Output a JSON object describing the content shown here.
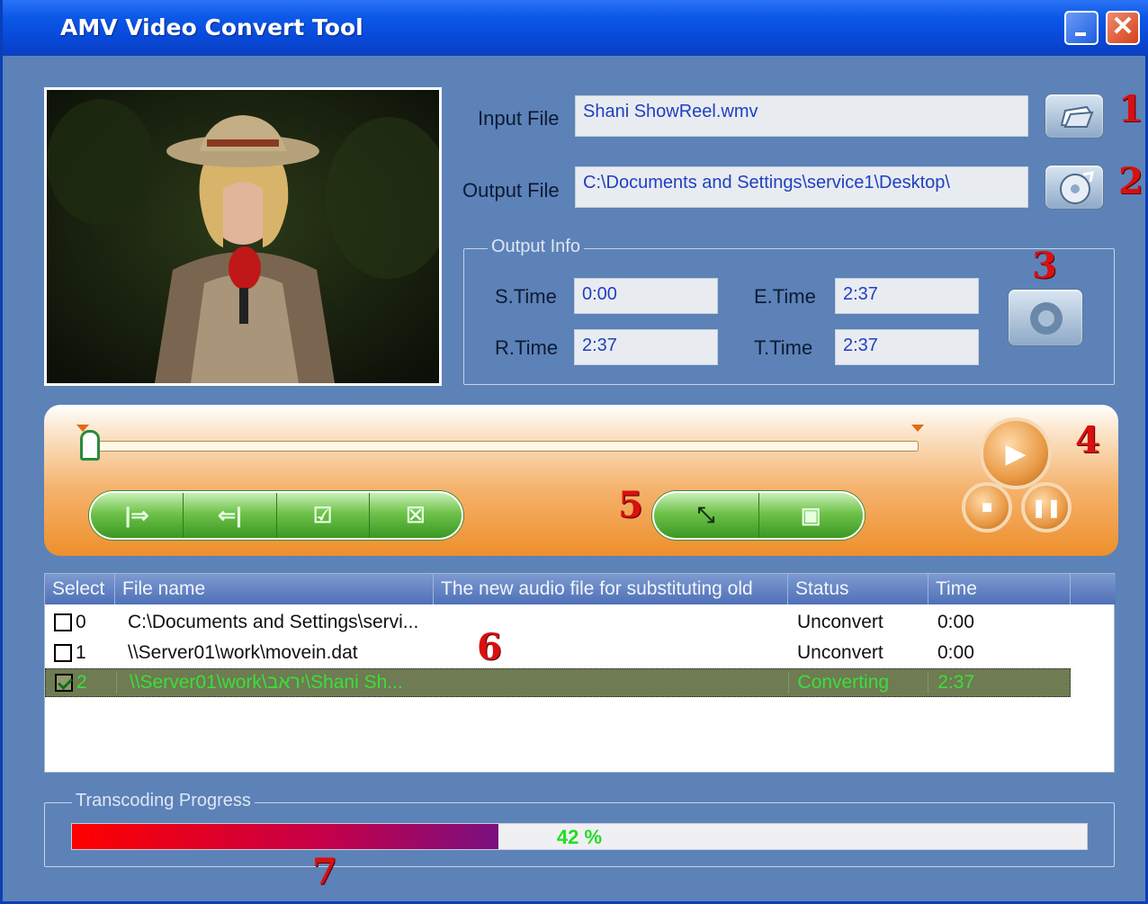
{
  "window": {
    "title": "AMV Video Convert Tool"
  },
  "input": {
    "label": "Input File",
    "value": "Shani ShowReel.wmv"
  },
  "output": {
    "label": "Output File",
    "value": "C:\\Documents and Settings\\service1\\Desktop\\"
  },
  "output_info": {
    "label": "Output Info",
    "s_time_label": "S.Time",
    "s_time": "0:00",
    "e_time_label": "E.Time",
    "e_time": "2:37",
    "r_time_label": "R.Time",
    "r_time": "2:37",
    "t_time_label": "T.Time",
    "t_time": "2:37"
  },
  "annotations": [
    "1",
    "2",
    "3",
    "4",
    "5",
    "6",
    "7"
  ],
  "table": {
    "headers": [
      "Select",
      "File name",
      "The new audio file for substituting old",
      "Status",
      "Time"
    ],
    "rows": [
      {
        "idx": "0",
        "file": "C:\\Documents and Settings\\servi...",
        "audio": "",
        "status": "Unconvert",
        "time": "0:00",
        "checked": false
      },
      {
        "idx": "1",
        "file": "\\\\Server01\\work\\movein.dat",
        "audio": "",
        "status": "Unconvert",
        "time": "0:00",
        "checked": false
      },
      {
        "idx": "2",
        "file": "\\\\Server01\\work\\יראב\\Shani Sh...",
        "audio": "",
        "status": "Converting",
        "time": "2:37",
        "checked": true
      }
    ]
  },
  "progress": {
    "label": "Transcoding Progress",
    "value": 0.42,
    "text": "42 %"
  },
  "colors": {
    "accent": "#0a3fb8",
    "panel": "#5c82b8",
    "player": "#ee8f2c",
    "pill": "#3a9822"
  }
}
